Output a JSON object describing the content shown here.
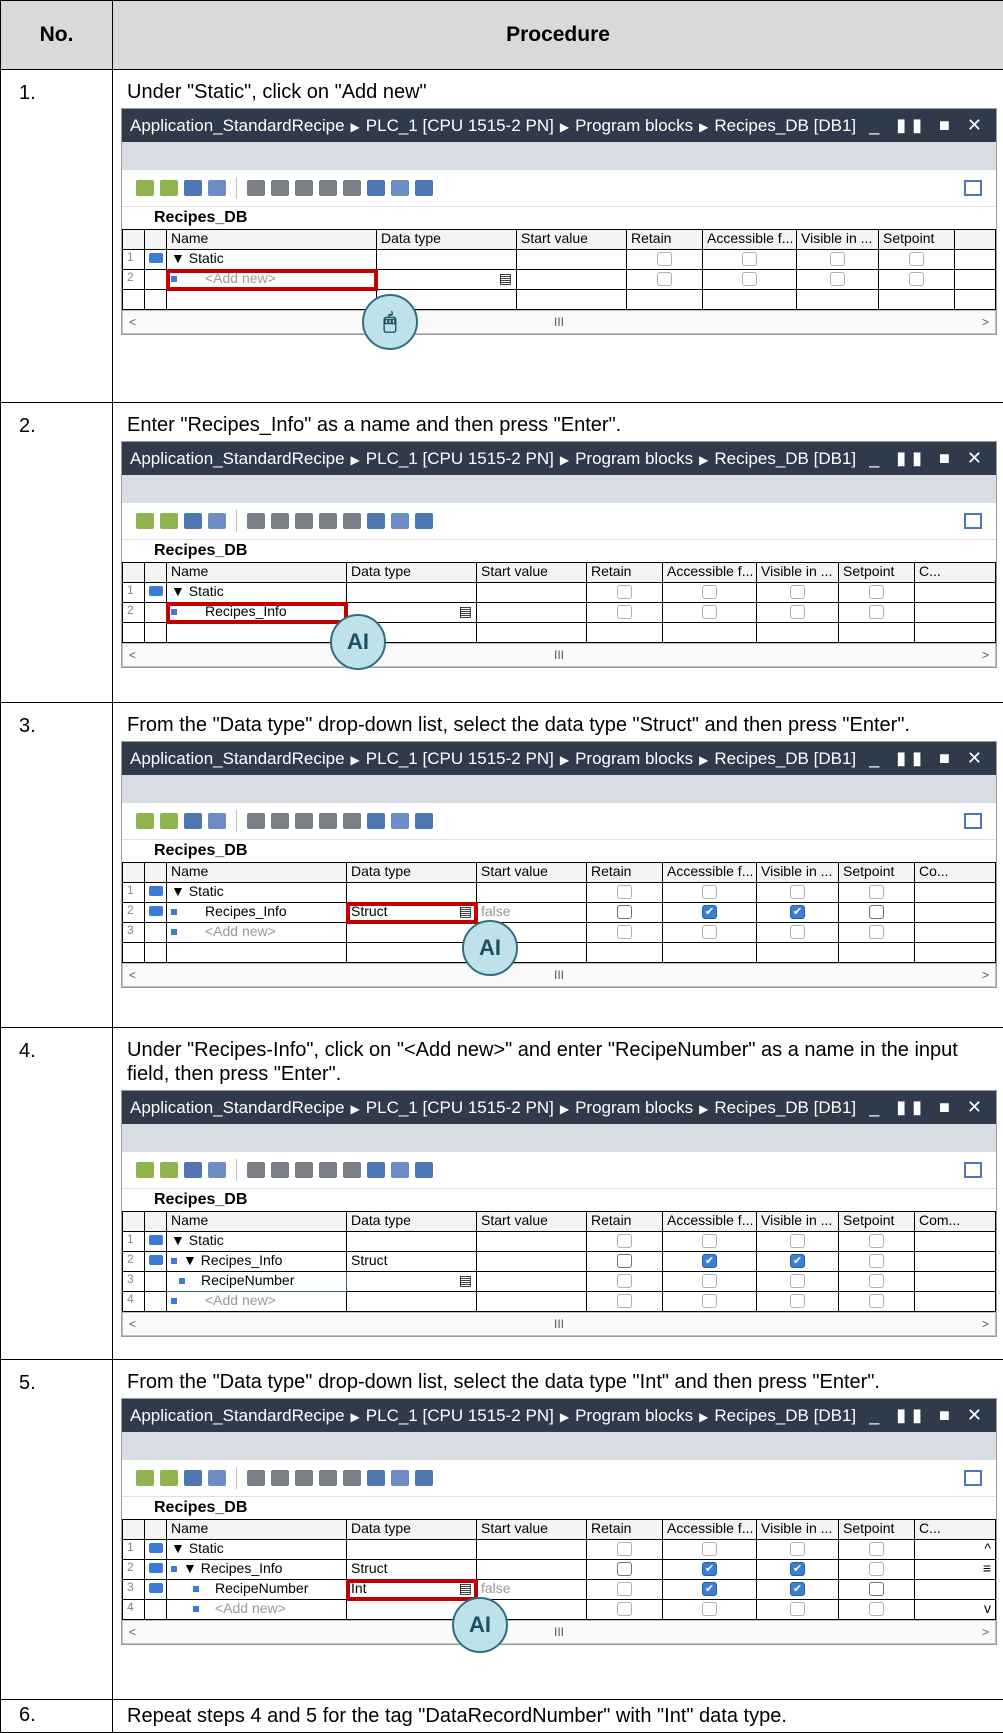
{
  "header": {
    "no": "No.",
    "procedure": "Procedure"
  },
  "window": {
    "path": [
      "Application_StandardRecipe",
      "PLC_1 [CPU 1515-2 PN]",
      "Program blocks",
      "Recipes_DB [DB1]"
    ],
    "db_name": "Recipes_DB",
    "columns": [
      "Name",
      "Data type",
      "Start value",
      "Retain",
      "Accessible f...",
      "Visible in ...",
      "Setpoint"
    ],
    "static": "Static",
    "add_new": "<Add new>",
    "struct": "Struct",
    "int": "Int",
    "false": "false"
  },
  "steps": [
    {
      "num": "1.",
      "text": "Under \"Static\", click on \"Add new\"",
      "name_value": "<Add new>"
    },
    {
      "num": "2.",
      "text": "Enter \"Recipes_Info\" as a name and then press \"Enter\".",
      "name_value": "Recipes_Info"
    },
    {
      "num": "3.",
      "text": "From the \"Data type\" drop-down list, select the data type \"Struct\" and then press \"Enter\".",
      "name_value": "Recipes_Info"
    },
    {
      "num": "4.",
      "text": "Under \"Recipes-Info\", click on \"<Add new>\" and enter \"RecipeNumber\" as a name in the input field, then press \"Enter\".",
      "name_value": "RecipeNumber"
    },
    {
      "num": "5.",
      "text": "From the \"Data type\" drop-down list, select the data type \"Int\" and then press \"Enter\".",
      "name_value": "RecipeNumber"
    },
    {
      "num": "6.",
      "text": "Repeat steps 4 and 5 for the tag \"DataRecordNumber\" with \"Int\" data type."
    }
  ]
}
